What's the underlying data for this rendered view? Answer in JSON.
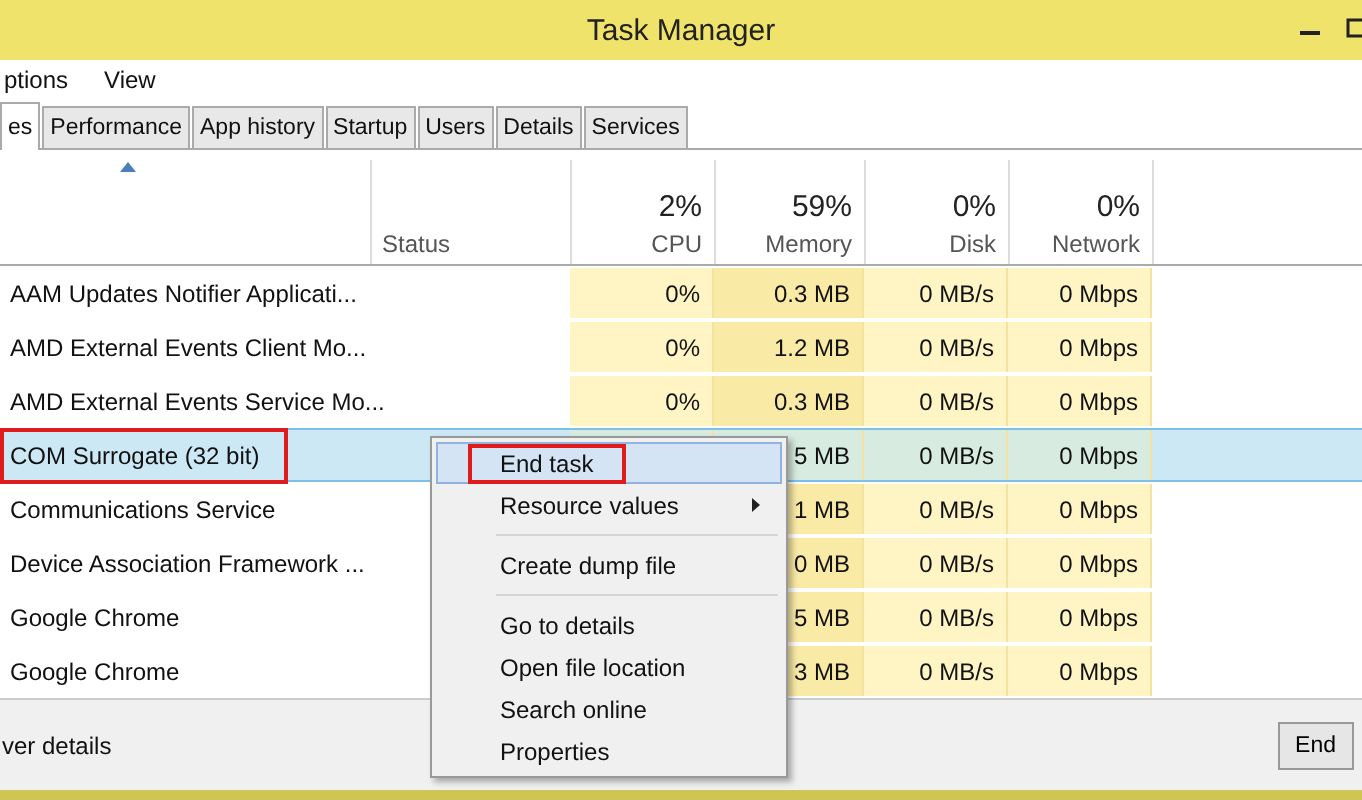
{
  "window": {
    "title": "Task Manager"
  },
  "menu_bar": [
    "ptions",
    "View"
  ],
  "tabs": [
    {
      "label": "es",
      "selected": true
    },
    {
      "label": "Performance",
      "selected": false
    },
    {
      "label": "App history",
      "selected": false
    },
    {
      "label": "Startup",
      "selected": false
    },
    {
      "label": "Users",
      "selected": false
    },
    {
      "label": "Details",
      "selected": false
    },
    {
      "label": "Services",
      "selected": false
    }
  ],
  "table": {
    "columns": [
      {
        "label": "Status"
      },
      {
        "label": "CPU",
        "total": "2%"
      },
      {
        "label": "Memory",
        "total": "59%"
      },
      {
        "label": "Disk",
        "total": "0%"
      },
      {
        "label": "Network",
        "total": "0%"
      }
    ],
    "rows": [
      {
        "name": "AAM Updates Notifier Applicati...",
        "cpu": "0%",
        "memory": "0.3 MB",
        "disk": "0 MB/s",
        "network": "0 Mbps",
        "selected": false,
        "annotated": false
      },
      {
        "name": "AMD External Events Client Mo...",
        "cpu": "0%",
        "memory": "1.2 MB",
        "disk": "0 MB/s",
        "network": "0 Mbps",
        "selected": false,
        "annotated": false
      },
      {
        "name": "AMD External Events Service Mo...",
        "cpu": "0%",
        "memory": "0.3 MB",
        "disk": "0 MB/s",
        "network": "0 Mbps",
        "selected": false,
        "annotated": false
      },
      {
        "name": "COM Surrogate (32 bit)",
        "memory": "5 MB",
        "disk": "0 MB/s",
        "network": "0 Mbps",
        "selected": true,
        "annotated": true
      },
      {
        "name": "Communications Service",
        "memory": "1 MB",
        "disk": "0 MB/s",
        "network": "0 Mbps",
        "selected": false,
        "annotated": false
      },
      {
        "name": "Device Association Framework ...",
        "memory": "0 MB",
        "disk": "0 MB/s",
        "network": "0 Mbps",
        "selected": false,
        "annotated": false
      },
      {
        "name": "Google Chrome",
        "memory": "5 MB",
        "disk": "0 MB/s",
        "network": "0 Mbps",
        "selected": false,
        "annotated": false
      },
      {
        "name": "Google Chrome",
        "memory": "3 MB",
        "disk": "0 MB/s",
        "network": "0 Mbps",
        "selected": false,
        "annotated": false
      }
    ]
  },
  "context_menu": [
    {
      "kind": "item",
      "label": "End task",
      "selected": true,
      "annotated": true
    },
    {
      "kind": "submenu",
      "label": "Resource values",
      "selected": false,
      "annotated": false
    },
    {
      "kind": "separator"
    },
    {
      "kind": "item",
      "label": "Create dump file",
      "selected": false,
      "annotated": false
    },
    {
      "kind": "separator"
    },
    {
      "kind": "item",
      "label": "Go to details",
      "selected": false,
      "annotated": false
    },
    {
      "kind": "item",
      "label": "Open file location",
      "selected": false,
      "annotated": false
    },
    {
      "kind": "item",
      "label": "Search online",
      "selected": false,
      "annotated": false
    },
    {
      "kind": "item",
      "label": "Properties",
      "selected": false,
      "annotated": false
    }
  ],
  "footer": {
    "details_link": "ver details",
    "end_button": "End"
  }
}
